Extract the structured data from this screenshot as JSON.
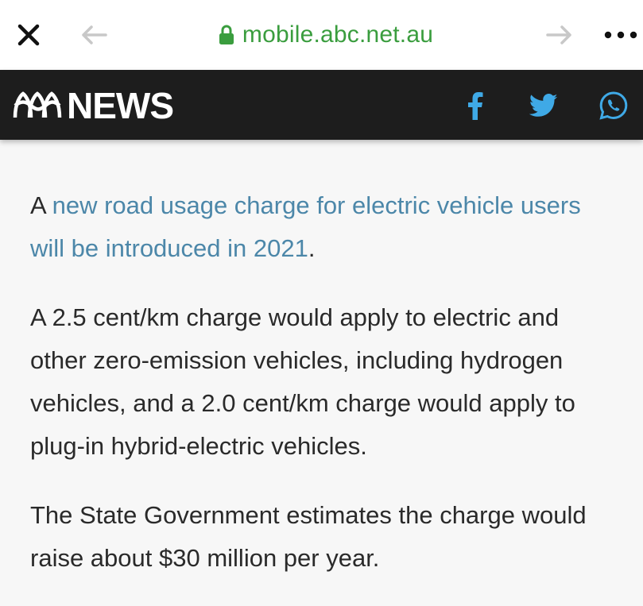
{
  "browser": {
    "url": "mobile.abc.net.au",
    "icons": {
      "close": "close-icon",
      "back": "arrow-left-icon",
      "forward": "arrow-right-icon",
      "more": "more-icon",
      "lock": "lock-icon"
    }
  },
  "header": {
    "brand": "NEWS",
    "logo_icon": "abc-logo-icon",
    "share_icons": [
      "facebook-icon",
      "twitter-icon",
      "whatsapp-icon"
    ]
  },
  "article": {
    "p1_prefix": "A ",
    "p1_link": "new road usage charge for electric vehicle users will be introduced in 2021",
    "p1_suffix": ".",
    "p2": "A 2.5 cent/km charge would apply to electric and other zero-emission vehicles, including hydrogen vehicles, and a 2.0 cent/km charge would apply to plug-in hybrid-electric vehicles.",
    "p3": "The State Government estimates the charge would raise about $30 million per year."
  },
  "colors": {
    "url_green": "#3a9d3e",
    "link_blue": "#4c87a9",
    "nav_bg": "#1d1d1d",
    "social_blue": "#3fa9e6"
  }
}
